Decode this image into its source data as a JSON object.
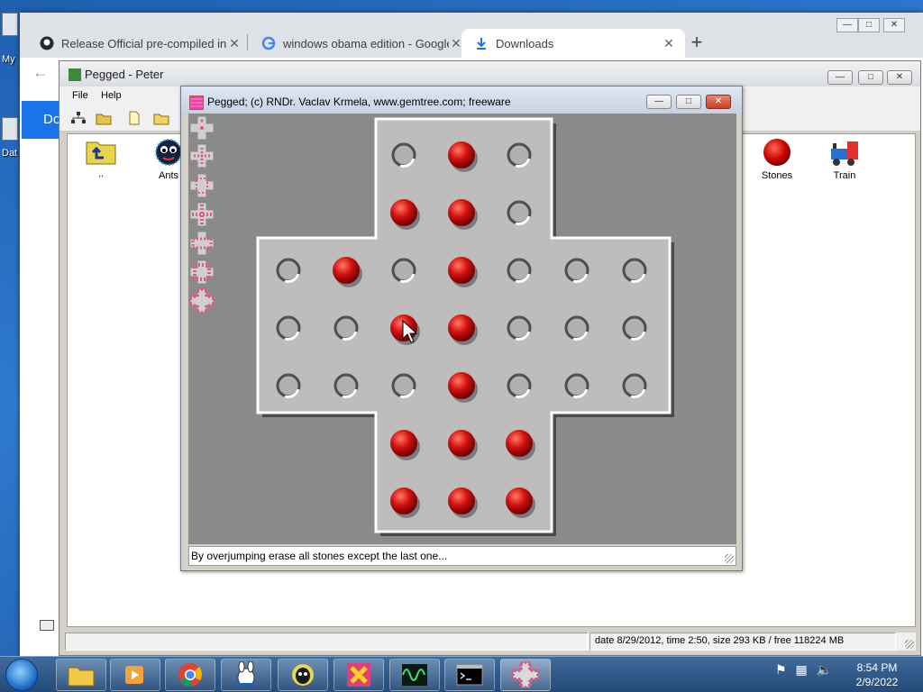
{
  "desktop": {
    "labels": [
      "My",
      "Dat"
    ]
  },
  "chrome": {
    "tabs": [
      {
        "title": "Release Official pre-compiled ins",
        "icon": "github-icon"
      },
      {
        "title": "windows obama edition - Google",
        "icon": "google-icon"
      },
      {
        "title": "Downloads",
        "icon": "download-icon"
      }
    ],
    "page_heading_partial": "Do"
  },
  "peter_window": {
    "title": "Pegged - Peter",
    "menu": [
      "File",
      "Help"
    ],
    "files": [
      {
        "label": "..",
        "icon": "folder-up-icon"
      },
      {
        "label": "Ants",
        "icon": "ant-face-icon"
      },
      {
        "label": "Stones",
        "icon": "red-stone-icon"
      },
      {
        "label": "Train",
        "icon": "train-icon"
      }
    ],
    "status": "date 8/29/2012, time 2:50, size 293 KB / free 118224 MB"
  },
  "game_window": {
    "title": "Pegged;   (c) RNDr. Vaclav Krmela, www.gemtree.com;   freeware",
    "status": "By overjumping erase all stones except the last one...",
    "board": [
      "  .O.  ",
      "  OO.  ",
      ".O.O...",
      "..OO...",
      "...O...",
      "  OOO  ",
      "  OOO  "
    ]
  },
  "taskbar": {
    "apps": [
      "explorer-icon",
      "media-player-icon",
      "chrome-icon",
      "rabbit-app-icon",
      "alien-app-icon",
      "x-app-icon",
      "oscilloscope-icon",
      "command-prompt-icon",
      "pegged-icon"
    ],
    "time": "8:54 PM",
    "date": "2/9/2022"
  }
}
